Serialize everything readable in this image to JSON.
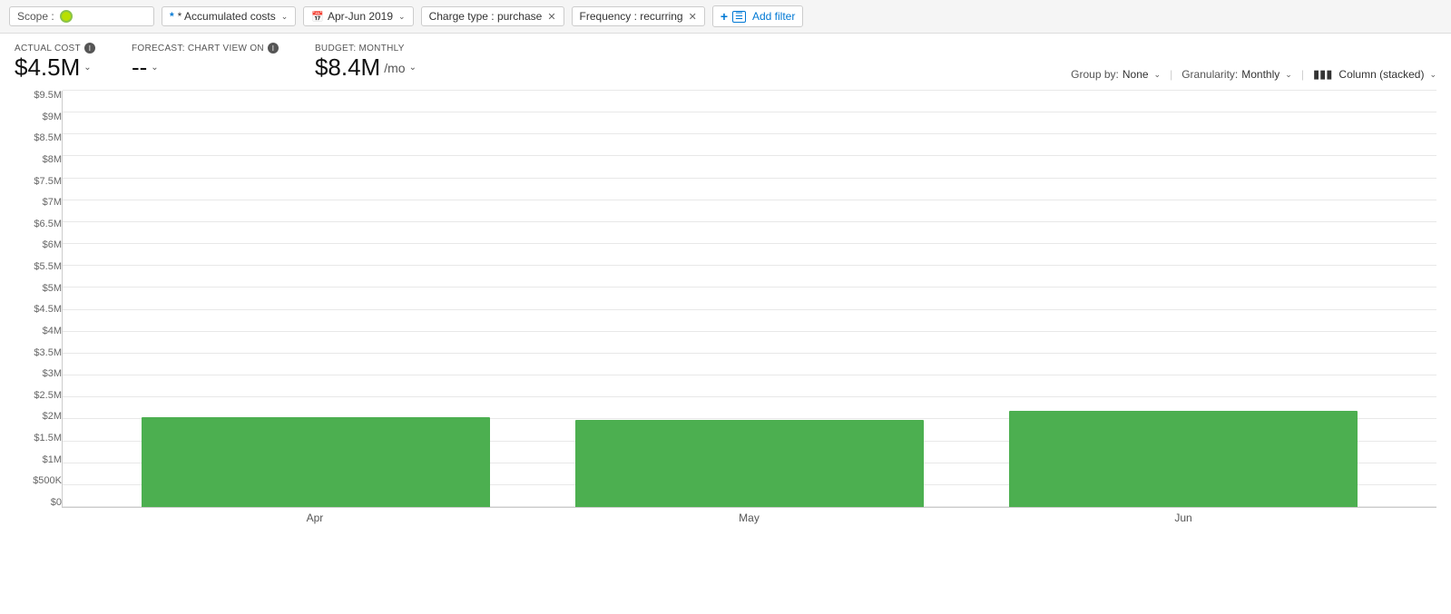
{
  "toolbar": {
    "scope_label": "Scope :",
    "scope_dot_color": "#b8e000",
    "accumulated_costs_label": "* Accumulated costs",
    "date_range_label": "Apr-Jun 2019",
    "charge_type_label": "Charge type : purchase",
    "frequency_label": "Frequency : recurring",
    "add_filter_label": "Add filter"
  },
  "metrics": {
    "actual_cost_label": "ACTUAL COST",
    "actual_cost_value": "$4.5M",
    "forecast_label": "FORECAST: CHART VIEW ON",
    "forecast_value": "--",
    "budget_label": "BUDGET: MONTHLY",
    "budget_value": "$8.4M",
    "budget_unit": "/mo"
  },
  "chart_controls": {
    "group_by_label": "Group by:",
    "group_by_value": "None",
    "granularity_label": "Granularity:",
    "granularity_value": "Monthly",
    "view_label": "Column (stacked)"
  },
  "chart": {
    "y_axis_labels": [
      "$0",
      "$500K",
      "$1M",
      "$1.5M",
      "$2M",
      "$2.5M",
      "$3M",
      "$3.5M",
      "$4M",
      "$4.5M",
      "$5M",
      "$5.5M",
      "$6M",
      "$6.5M",
      "$7M",
      "$7.5M",
      "$8M",
      "$8.5M",
      "$9M",
      "$9.5M"
    ],
    "bars": [
      {
        "month": "Apr",
        "value": 2050000,
        "color": "#4caf50"
      },
      {
        "month": "May",
        "value": 1980000,
        "color": "#4caf50"
      },
      {
        "month": "Jun",
        "value": 2200000,
        "color": "#4caf50"
      }
    ],
    "max_value": 9500000,
    "bar_color": "#4caf50"
  },
  "icons": {
    "calendar": "📅",
    "chart_column": "📊",
    "add_filter_icon": "⊕",
    "chevron_down": "∨",
    "info": "i"
  }
}
